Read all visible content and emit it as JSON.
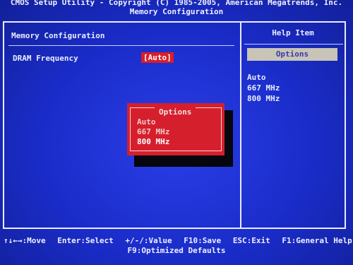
{
  "header": {
    "copyright": "CMOS Setup Utility - Copyright (C) 1985-2005, American Megatrends, Inc.",
    "screen_title": "Memory Configuration"
  },
  "left_panel": {
    "title": "Memory Configuration",
    "settings": [
      {
        "label": "DRAM Frequency",
        "value": "[Auto]"
      }
    ]
  },
  "help_panel": {
    "title": "Help Item",
    "box_label": "Options",
    "options": [
      "Auto",
      "667 MHz",
      "800 MHz"
    ]
  },
  "popup": {
    "title": "Options",
    "options": [
      "Auto",
      "667 MHz",
      "800 MHz"
    ],
    "selected": "800 MHz"
  },
  "footer": {
    "move": "↑↓←→:Move",
    "select": "Enter:Select",
    "value": "+/-/:Value",
    "save": "F10:Save",
    "exit": "ESC:Exit",
    "help": "F1:General Help",
    "defaults": "F9:Optimized Defaults"
  },
  "colors": {
    "background": "#1a2cc8",
    "highlight": "#d81e2a",
    "text": "#e8ecff"
  }
}
